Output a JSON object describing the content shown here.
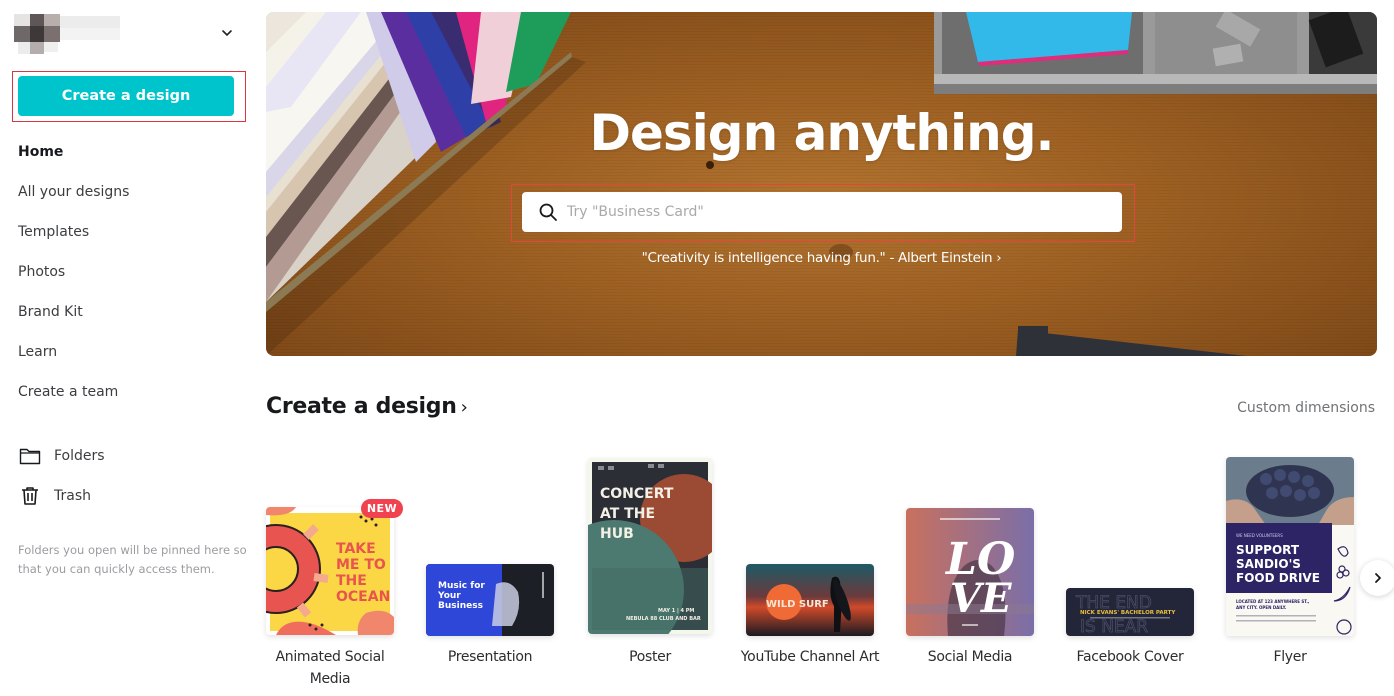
{
  "sidebar": {
    "account_chevron_icon": "chevron-down-icon",
    "create_button_label": "Create a design",
    "nav_items": [
      {
        "label": "Home",
        "active": true
      },
      {
        "label": "All your designs",
        "active": false
      },
      {
        "label": "Templates",
        "active": false
      },
      {
        "label": "Photos",
        "active": false
      },
      {
        "label": "Brand Kit",
        "active": false
      },
      {
        "label": "Learn",
        "active": false
      },
      {
        "label": "Create a team",
        "active": false
      }
    ],
    "folders_label": "Folders",
    "trash_label": "Trash",
    "pinned_hint": "Folders you open will be pinned here so that you can quickly access them."
  },
  "hero": {
    "title": "Design anything.",
    "search_placeholder": "Try \"Business Card\"",
    "search_value": "",
    "quote": "\"Creativity is intelligence having fun.\" - Albert Einstein ›"
  },
  "create_section": {
    "title": "Create a design",
    "title_chevron": "›",
    "custom_dimensions_label": "Custom dimensions",
    "new_badge": "NEW",
    "tiles": [
      {
        "label": "Animated Social Media",
        "thumb_text": [
          "TAKE",
          "ME TO",
          "THE",
          "OCEAN"
        ]
      },
      {
        "label": "Presentation",
        "thumb_text": [
          "Music for",
          "Your",
          "Business"
        ]
      },
      {
        "label": "Poster",
        "thumb_text": [
          "CONCERT",
          "AT THE",
          "HUB",
          "MAY 1 | 4 PM",
          "NEBULA 88 CLUB AND BAR"
        ]
      },
      {
        "label": "YouTube Channel Art",
        "thumb_text": [
          "WILD SURF"
        ]
      },
      {
        "label": "Social Media",
        "thumb_text": [
          "LO",
          "VE"
        ]
      },
      {
        "label": "Facebook Cover",
        "thumb_text": [
          "THE END",
          "IS NEAR",
          "NICK EVANS' BACHELOR PARTY"
        ]
      },
      {
        "label": "Flyer",
        "thumb_text": [
          "WE NEED VOLUNTEERS",
          "SUPPORT",
          "SANDIO'S",
          "FOOD DRIVE",
          "LOCATED AT 123 ANYWHERE ST., ANY CITY. OPEN DAILY."
        ]
      }
    ],
    "next_icon": "chevron-right-icon"
  },
  "colors": {
    "accent": "#00c4cc",
    "badge": "#f0424f",
    "highlight_outline": "#d9363e"
  }
}
